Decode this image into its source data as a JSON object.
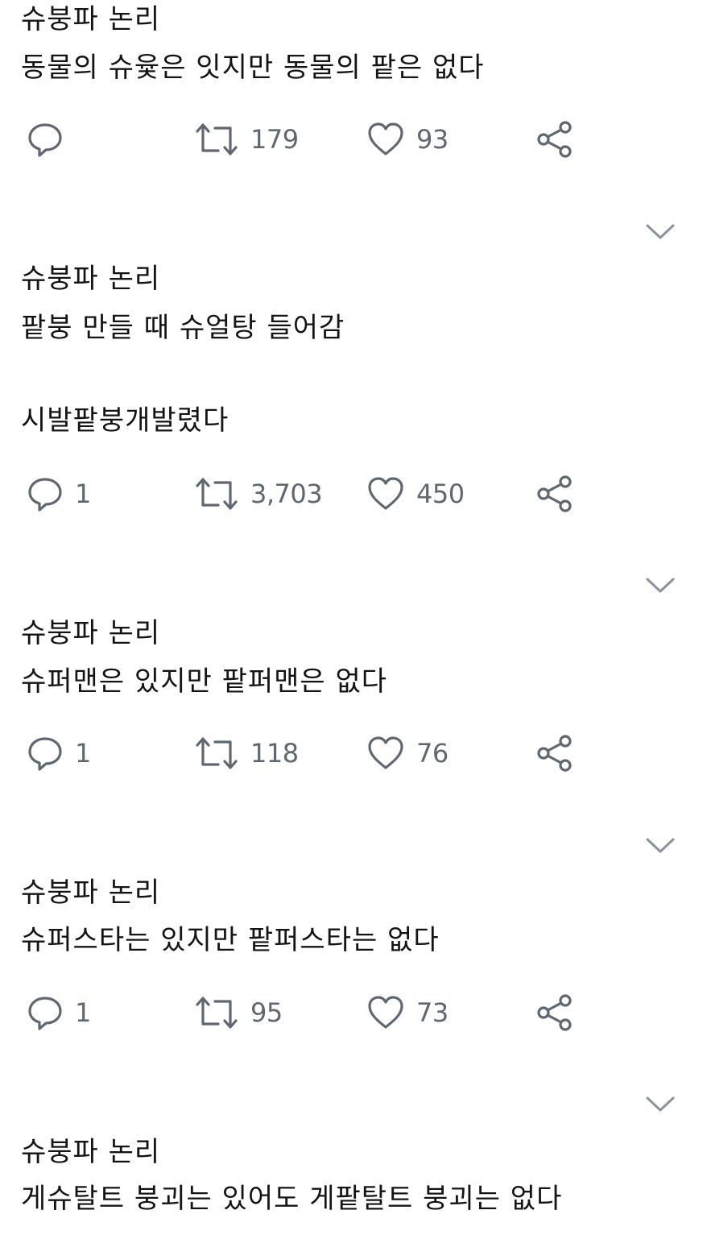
{
  "tweets": [
    {
      "author": "슈붕파 논리",
      "lines": [
        "동물의 슈윷은 잇지만 동물의 팥은 없다"
      ],
      "actions": {
        "reply": "",
        "retweet": "179",
        "like": "93"
      }
    },
    {
      "author": "슈붕파 논리",
      "lines": [
        "팥붕 만들 때 슈얼탕 들어감",
        "시발팥붕개발렸다"
      ],
      "actions": {
        "reply": "1",
        "retweet": "3,703",
        "like": "450"
      }
    },
    {
      "author": "슈붕파 논리",
      "lines": [
        "슈퍼맨은 있지만 팥퍼맨은 없다"
      ],
      "actions": {
        "reply": "1",
        "retweet": "118",
        "like": "76"
      }
    },
    {
      "author": "슈붕파 논리",
      "lines": [
        "슈퍼스타는 있지만 팥퍼스타는 없다"
      ],
      "actions": {
        "reply": "1",
        "retweet": "95",
        "like": "73"
      }
    },
    {
      "author": "슈붕파 논리",
      "lines": [
        "게슈탈트 붕괴는 있어도 게팥탈트 붕괴는 없다"
      ]
    }
  ],
  "icons": {
    "reply": "reply-icon",
    "retweet": "retweet-icon",
    "like": "heart-icon",
    "share": "share-icon",
    "menu": "chevron-down-icon"
  },
  "colors": {
    "icon": "#5f6870",
    "text": "#141414"
  }
}
